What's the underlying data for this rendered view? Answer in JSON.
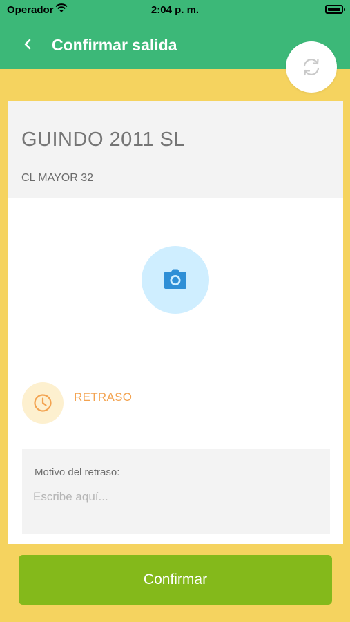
{
  "status_bar": {
    "carrier": "Operador",
    "time": "2:04 p. m."
  },
  "header": {
    "title": "Confirmar salida",
    "back_icon": "chevron-left-icon",
    "refresh_icon": "refresh-icon"
  },
  "company": {
    "name": "GUINDO 2011 SL",
    "address": "CL MAYOR 32"
  },
  "photo": {
    "icon": "camera-icon"
  },
  "delay": {
    "label": "RETRASO",
    "icon": "clock-icon",
    "reason_label": "Motivo del retraso:",
    "reason_placeholder": "Escribe aquí...",
    "reason_value": ""
  },
  "actions": {
    "confirm_label": "Confirmar"
  },
  "colors": {
    "header_green": "#3cb878",
    "background_yellow": "#f5d35f",
    "confirm_green": "#84b91b",
    "delay_orange": "#f3a350",
    "camera_blue": "#2f8fd6"
  }
}
